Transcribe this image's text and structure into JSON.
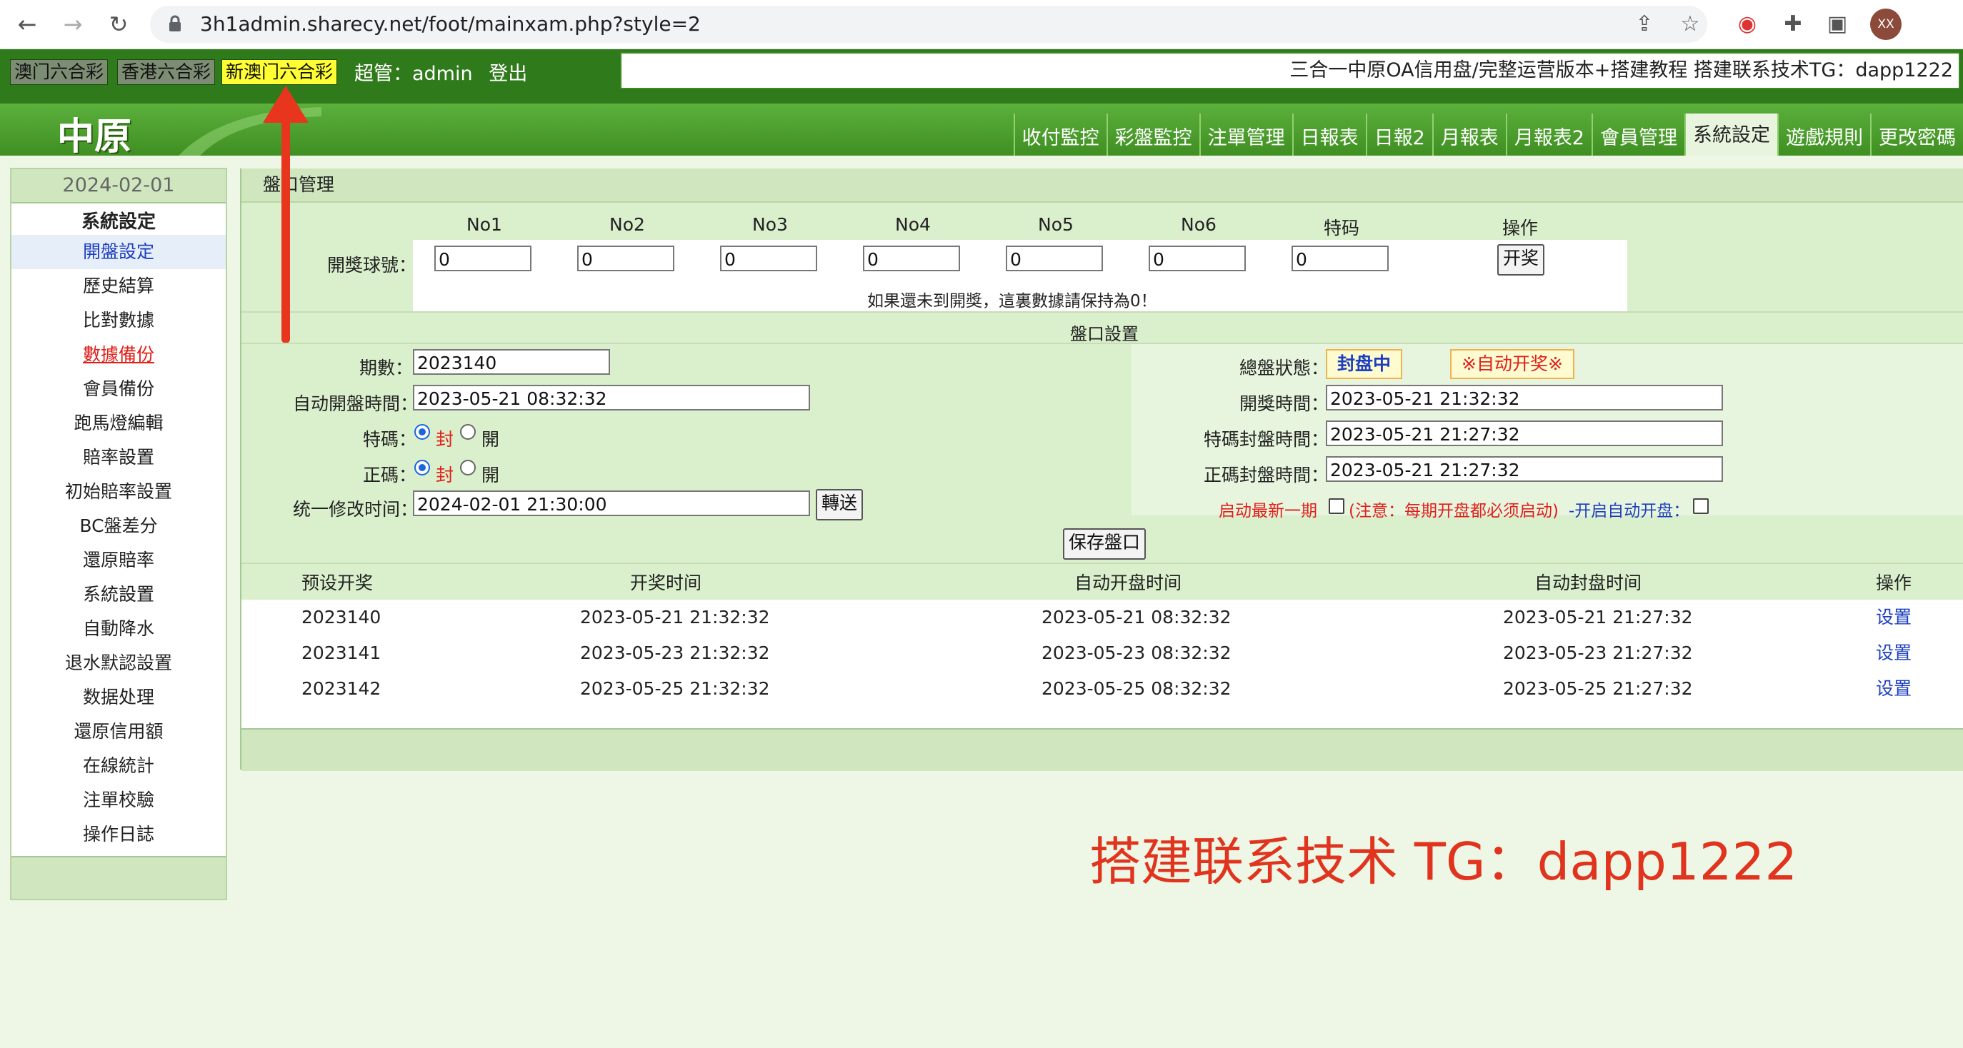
{
  "browser": {
    "url": "3h1admin.sharecy.net/foot/mainxam.php?style=2",
    "avatar": "XX"
  },
  "topbar": {
    "game_tabs": [
      "澳门六合彩",
      "香港六合彩",
      "新澳门六合彩"
    ],
    "user_role": "超管：admin",
    "logout": "登出",
    "marquee": "三合一中原OA信用盘/完整运营版本+搭建教程 搭建联系技术TG：dapp1222"
  },
  "header": {
    "logo": "中原",
    "nav_tabs": [
      "收付監控",
      "彩盤監控",
      "注單管理",
      "日報表",
      "日報2",
      "月報表",
      "月報表2",
      "會員管理",
      "系統設定",
      "遊戲規則",
      "更改密碼"
    ],
    "active_nav": "系統設定"
  },
  "sidebar": {
    "date": "2024-02-01",
    "title": "系統設定",
    "items": [
      "開盤設定",
      "歷史結算",
      "比對數據",
      "數據備份",
      "會員備份",
      "跑馬燈編輯",
      "賠率設置",
      "初始賠率設置",
      "BC盤差分",
      "還原賠率",
      "系統設置",
      "自動降水",
      "退水默認設置",
      "数据处理",
      "還原信用額",
      "在線統計",
      "注單校驗",
      "操作日誌"
    ]
  },
  "panel": {
    "title": "盤口管理",
    "draw": {
      "columns": [
        "No1",
        "No2",
        "No3",
        "No4",
        "No5",
        "No6",
        "特码",
        "操作"
      ],
      "row_label": "開獎球號：",
      "values": [
        "0",
        "0",
        "0",
        "0",
        "0",
        "0",
        "0"
      ],
      "action": "开奖",
      "hint": "如果還未到開獎，這裏數據請保持為0！"
    },
    "settings": {
      "title": "盤口設置",
      "period_label": "期數：",
      "period": "2023140",
      "auto_open_label": "自动開盤時間：",
      "auto_open": "2023-05-21 08:32:32",
      "special_label": "特碼：",
      "normal_label": "正碼：",
      "opt_close": "封",
      "opt_open": "開",
      "unify_label": "统一修改时间：",
      "unify_time": "2024-02-01 21:30:00",
      "send": "轉送",
      "status_label": "總盤狀態：",
      "status": "封盘中",
      "auto_draw": "※自动开奖※",
      "draw_time_label": "開獎時間：",
      "draw_time": "2023-05-21 21:32:32",
      "special_close_label": "特碼封盤時間：",
      "special_close": "2023-05-21 21:27:32",
      "normal_close_label": "正碼封盤時間：",
      "normal_close": "2023-05-21 21:27:32",
      "latest_label": "启动最新一期",
      "note": "(注意：每期开盘都必须启动)",
      "auto_open_toggle": "-开启自动开盘：",
      "save": "保存盤口"
    },
    "schedule": {
      "headers": [
        "预设开奖",
        "开奖时间",
        "自动开盘时间",
        "自动封盘时间",
        "操作"
      ],
      "rows": [
        [
          "2023140",
          "2023-05-21 21:32:32",
          "2023-05-21 08:32:32",
          "2023-05-21 21:27:32",
          "设置"
        ],
        [
          "2023141",
          "2023-05-23 21:32:32",
          "2023-05-23 08:32:32",
          "2023-05-23 21:27:32",
          "设置"
        ],
        [
          "2023142",
          "2023-05-25 21:32:32",
          "2023-05-25 08:32:32",
          "2023-05-25 21:27:32",
          "设置"
        ]
      ]
    }
  },
  "watermark": "搭建联系技术 TG：dapp1222",
  "colors": {
    "dark_green": "#2f7a1a",
    "light_green": "#daefcc",
    "highlight_yellow": "#ffff33",
    "alert_red": "#e0201a",
    "link_blue": "#1d3fbf"
  }
}
